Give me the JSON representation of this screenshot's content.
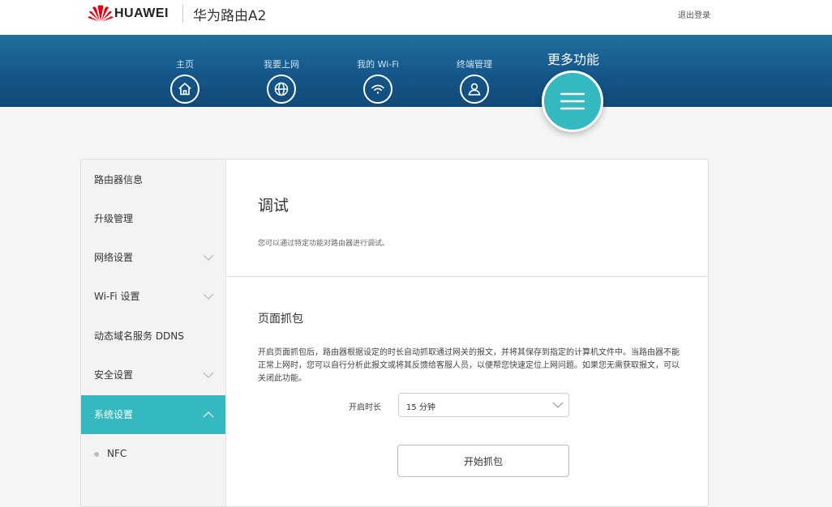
{
  "header": {
    "brand": "HUAWEI",
    "model": "华为路由A2",
    "logout": "退出登录"
  },
  "nav": {
    "items": [
      {
        "label": "主页",
        "icon": "home-icon"
      },
      {
        "label": "我要上网",
        "icon": "globe-icon"
      },
      {
        "label": "我的 Wi-Fi",
        "icon": "wifi-icon"
      },
      {
        "label": "终端管理",
        "icon": "user-icon"
      }
    ],
    "active": {
      "label": "更多功能",
      "icon": "menu-icon"
    }
  },
  "sidebar": {
    "items": [
      {
        "label": "路由器信息"
      },
      {
        "label": "升级管理"
      },
      {
        "label": "网络设置"
      },
      {
        "label": "Wi-Fi 设置"
      },
      {
        "label": "动态域名服务 DDNS"
      },
      {
        "label": "安全设置"
      },
      {
        "label": "系统设置"
      }
    ],
    "sub_items": [
      {
        "label": "NFC"
      }
    ]
  },
  "content": {
    "title": "调试",
    "description": "您可以通过特定功能对路由器进行调试。",
    "section": {
      "title": "页面抓包",
      "description": "开启页面抓包后，路由器根据设定的时长自动抓取通过网关的报文，并将其保存到指定的计算机文件中。当路由器不能正常上网时，您可以自行分析此报文或将其反馈给客服人员，以便帮您快速定位上网问题。如果您无需获取报文，可以关闭此功能。",
      "duration_label": "开启时长",
      "duration_value": "15 分钟",
      "start_button": "开始抓包"
    }
  },
  "colors": {
    "nav_band": "#15578a",
    "accent": "#33b9bf",
    "brand_red": "#e60012"
  }
}
